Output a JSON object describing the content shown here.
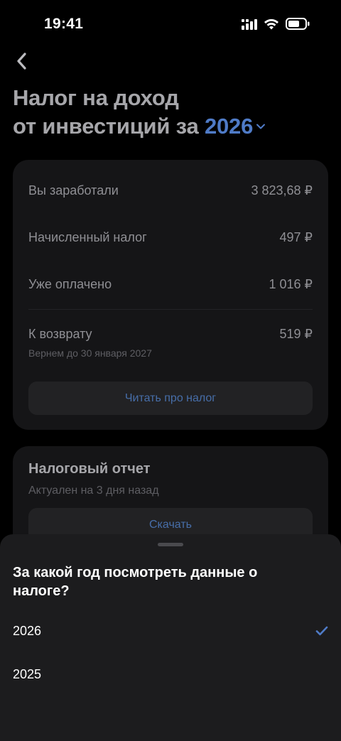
{
  "status_bar": {
    "time": "19:41"
  },
  "header": {
    "title_line1": "Налог на доход",
    "title_line2_prefix": "от инвестиций за",
    "selected_year": "2026"
  },
  "summary": {
    "rows": [
      {
        "label": "Вы заработали",
        "value": "3 823,68 ₽"
      },
      {
        "label": "Начисленный налог",
        "value": "497 ₽"
      },
      {
        "label": "Уже оплачено",
        "value": "1 016 ₽"
      },
      {
        "label": "К возврату",
        "value": "519 ₽",
        "sublabel": "Вернем до 30 января 2027"
      }
    ],
    "read_button_label": "Читать про налог"
  },
  "report": {
    "title": "Налоговый отчет",
    "subtitle": "Актуален на 3 дня назад",
    "download_label": "Скачать"
  },
  "year_sheet": {
    "title": "За какой год посмотреть данные о налоге?",
    "options": [
      {
        "label": "2026",
        "selected": true
      },
      {
        "label": "2025",
        "selected": false
      }
    ]
  },
  "colors": {
    "accent": "#4f7bc7",
    "background": "#000000",
    "card": "#151517",
    "sheet": "#1c1c1e"
  }
}
